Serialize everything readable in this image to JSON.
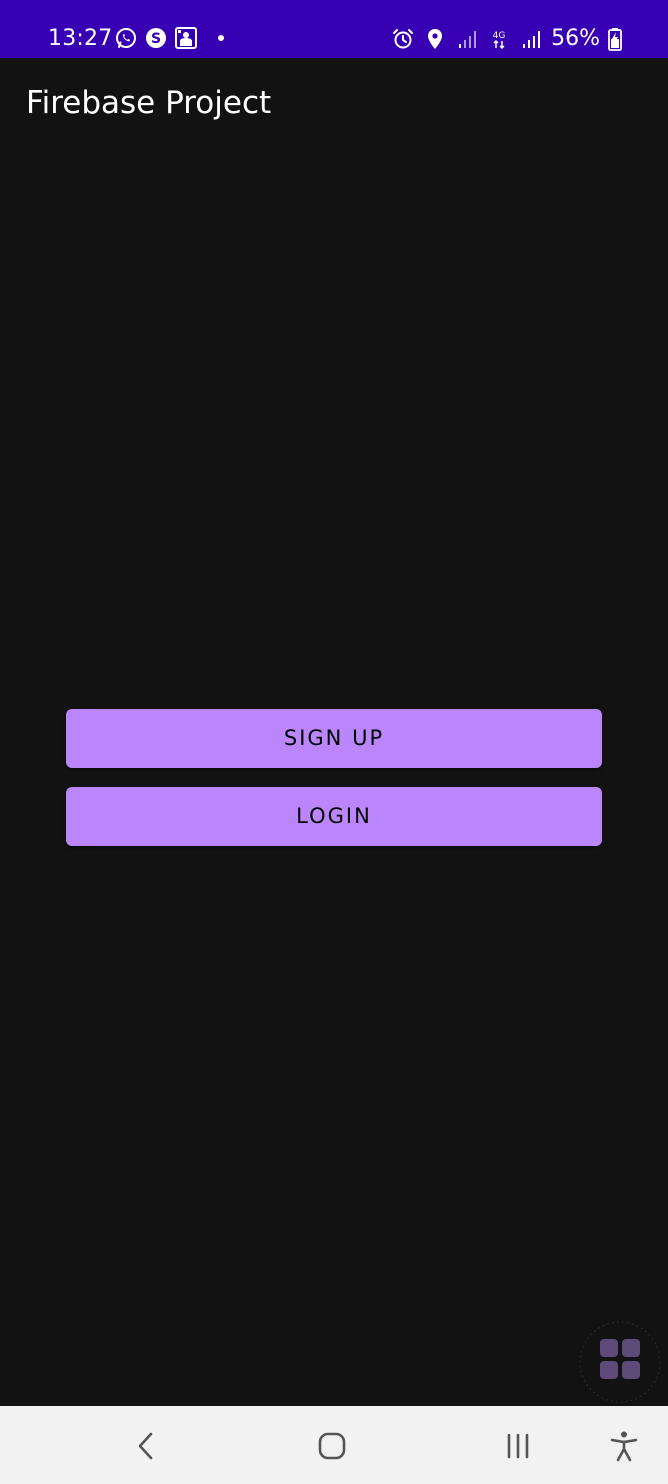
{
  "status_bar": {
    "time": "13:27",
    "battery": "56%",
    "icons_left": [
      "whatsapp-icon",
      "skype-icon",
      "gallery-notification-icon"
    ],
    "icons_right": [
      "alarm-icon",
      "location-icon",
      "signal-weak-icon",
      "4g-data-icon",
      "signal-icon",
      "battery-charging-icon"
    ],
    "background": "#3700B3"
  },
  "app_bar": {
    "title": "Firebase Project"
  },
  "buttons": {
    "signup_label": "SIGN UP",
    "login_label": "LOGIN",
    "color": "#BB86FC"
  },
  "floating_widget": {
    "icon": "apps-grid-icon"
  },
  "nav_bar": {
    "icons": [
      "back-icon",
      "home-icon",
      "recent-apps-icon",
      "accessibility-icon"
    ]
  },
  "colors": {
    "background": "#121212",
    "status_bar": "#3700B3",
    "accent": "#BB86FC",
    "nav_bar": "#f2f2f2"
  }
}
